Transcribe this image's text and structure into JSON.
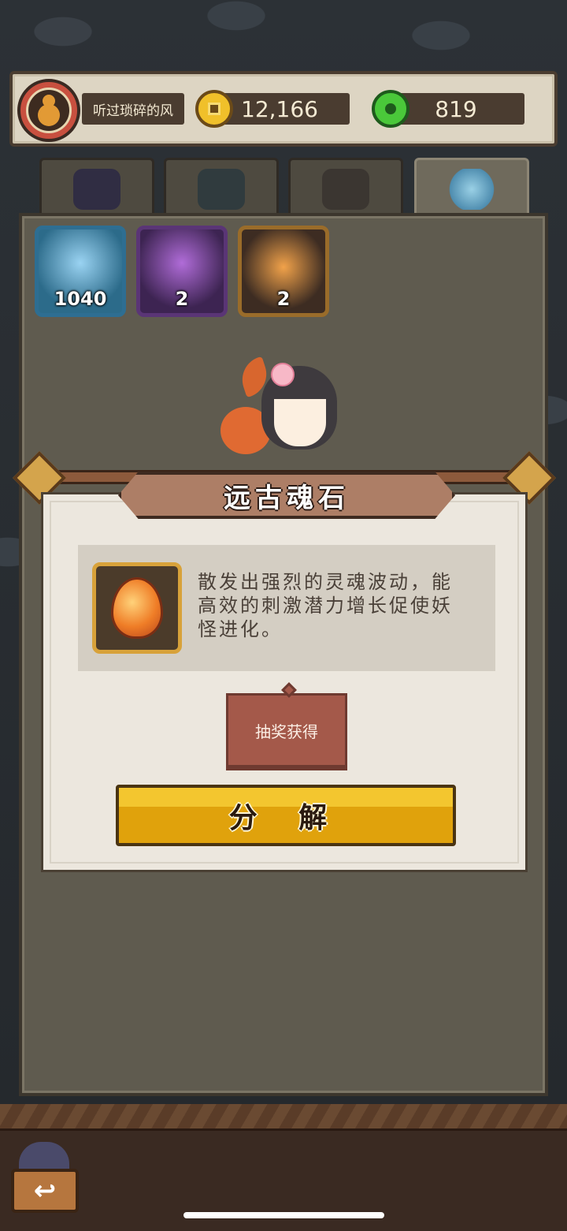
{
  "header": {
    "username": "听过琐碎的风",
    "gold": "12,166",
    "jade": "819"
  },
  "tabs": [
    {
      "name": "monsters",
      "icon": "monster-icon"
    },
    {
      "name": "scroll",
      "icon": "scroll-icon"
    },
    {
      "name": "food",
      "icon": "food-bowl-icon"
    },
    {
      "name": "soulstones",
      "icon": "crystal-icon",
      "active": true
    }
  ],
  "inventory": [
    {
      "icon": "blue-crystal-icon",
      "count": "1040"
    },
    {
      "icon": "purple-crystal-icon",
      "count": "2"
    },
    {
      "icon": "orange-soulstone-icon",
      "count": "2"
    }
  ],
  "dialog": {
    "title": "远古魂石",
    "description": "散发出强烈的灵魂波动，能高效的刺激潜力增长促使妖怪进化。",
    "source": "抽奖获得",
    "action": "分 解"
  },
  "colors": {
    "accent_gold": "#f3c62f",
    "tag_red": "#a4594a",
    "panel": "#5f5b4f"
  }
}
